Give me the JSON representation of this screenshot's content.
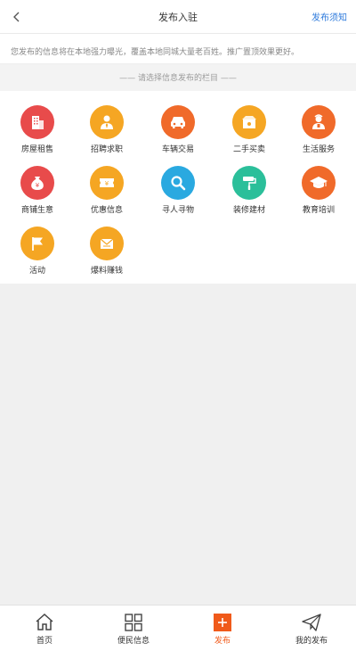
{
  "header": {
    "title": "发布入驻",
    "notice_link": "发布须知"
  },
  "intro": {
    "text": "您发布的信息将在本地强力曝光，覆盖本地同城大量老百姓。推广置顶效果更好。"
  },
  "section": {
    "title": "—— 请选择信息发布的栏目 ——"
  },
  "categories": [
    {
      "label": "房屋租售",
      "icon": "building-icon",
      "color": "#e84b4b"
    },
    {
      "label": "招聘求职",
      "icon": "person-tie-icon",
      "color": "#f5a623"
    },
    {
      "label": "车辆交易",
      "icon": "car-icon",
      "color": "#f06a2a"
    },
    {
      "label": "二手买卖",
      "icon": "box-icon",
      "color": "#f5a623"
    },
    {
      "label": "生活服务",
      "icon": "service-person-icon",
      "color": "#f06a2a"
    },
    {
      "label": "商铺生意",
      "icon": "money-bag-icon",
      "color": "#e84b4b"
    },
    {
      "label": "优惠信息",
      "icon": "coupon-icon",
      "color": "#f5a623"
    },
    {
      "label": "寻人寻物",
      "icon": "magnifier-icon",
      "color": "#2aa9e0"
    },
    {
      "label": "装修建材",
      "icon": "paint-roller-icon",
      "color": "#2bbf9a"
    },
    {
      "label": "教育培训",
      "icon": "graduation-cap-icon",
      "color": "#f06a2a"
    },
    {
      "label": "活动",
      "icon": "flag-icon",
      "color": "#f5a623"
    },
    {
      "label": "爆料赚钱",
      "icon": "envelope-icon",
      "color": "#f5a623"
    }
  ],
  "tabbar": {
    "items": [
      {
        "label": "首页",
        "icon": "home-icon"
      },
      {
        "label": "便民信息",
        "icon": "grid-icon"
      },
      {
        "label": "发布",
        "icon": "plus-icon",
        "active": true
      },
      {
        "label": "我的发布",
        "icon": "paper-plane-icon"
      }
    ]
  },
  "colors": {
    "accent": "#f05a1a",
    "link": "#2f7bdc",
    "background": "#f0f0f0"
  }
}
